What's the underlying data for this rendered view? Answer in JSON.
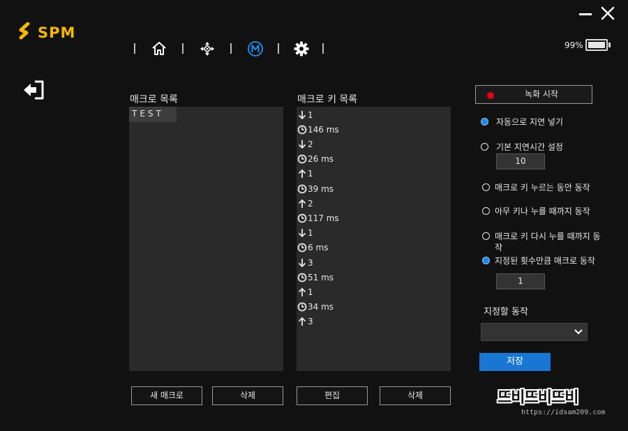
{
  "app": {
    "brand": "SPM",
    "brand_color": "#f5b800"
  },
  "window": {
    "minimize": "minimize-icon",
    "close": "close-icon"
  },
  "nav": {
    "items": [
      "home-icon",
      "dpad-icon",
      "macro-m-icon",
      "gear-icon"
    ],
    "active": "macro-m-icon",
    "active_color": "#1e88e5"
  },
  "battery": {
    "percent_label": "99%",
    "level": 0.99
  },
  "macro_list": {
    "title": "매크로 목록",
    "items": [
      {
        "label": "TEST",
        "selected": true
      }
    ]
  },
  "key_list": {
    "title": "매크로 키 목록",
    "rows": [
      {
        "icon": "arrow-down-icon",
        "text": "1"
      },
      {
        "icon": "clock-icon",
        "text": "146 ms"
      },
      {
        "icon": "arrow-down-icon",
        "text": "2"
      },
      {
        "icon": "clock-icon",
        "text": "26 ms"
      },
      {
        "icon": "arrow-up-icon",
        "text": "1"
      },
      {
        "icon": "clock-icon",
        "text": "39 ms"
      },
      {
        "icon": "arrow-up-icon",
        "text": "2"
      },
      {
        "icon": "clock-icon",
        "text": "117 ms"
      },
      {
        "icon": "arrow-down-icon",
        "text": "1"
      },
      {
        "icon": "clock-icon",
        "text": "6 ms"
      },
      {
        "icon": "arrow-down-icon",
        "text": "3"
      },
      {
        "icon": "clock-icon",
        "text": "51 ms"
      },
      {
        "icon": "arrow-up-icon",
        "text": "1"
      },
      {
        "icon": "clock-icon",
        "text": "34 ms"
      },
      {
        "icon": "arrow-up-icon",
        "text": "3"
      }
    ]
  },
  "buttons": {
    "new_macro": "새 매크로",
    "delete_macro": "삭제",
    "edit": "편집",
    "delete_key": "삭제"
  },
  "recording": {
    "label": "녹화 시작",
    "dot_color": "#e60012"
  },
  "delay": {
    "auto_label": "자동으로 지연 넣기",
    "auto_checked": true,
    "default_label": "기본 지연시간 설정",
    "default_checked": false,
    "default_value": "10"
  },
  "repeat": {
    "while_pressed": "매크로 키 누르는 동안 동작",
    "until_any_key": "아무 키나 누를 때까지 동작",
    "until_press_again_line1": "매크로 키 다시 누를 때까지 동",
    "until_press_again_line2": "작",
    "fixed_count": "지정된 횟수만큼 매크로 동작",
    "selected": "fixed_count",
    "count_value": "1"
  },
  "assign": {
    "label": "지정할 동작",
    "selected_value": ""
  },
  "save_label": "저장",
  "watermark": {
    "main": "뜨비뜨비뜨비",
    "url": "https://idsam209.com"
  }
}
